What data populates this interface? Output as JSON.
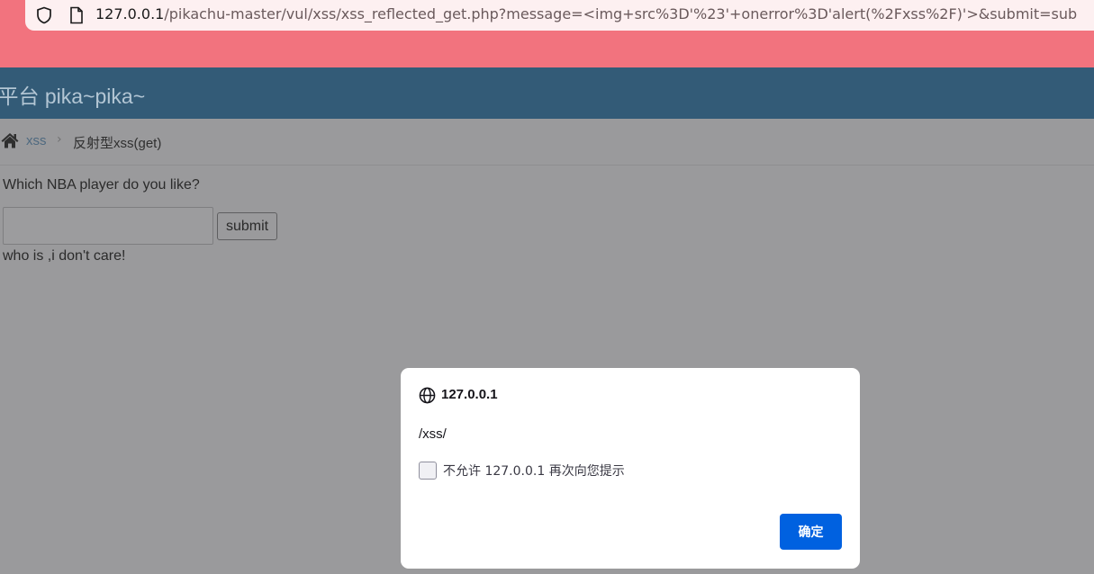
{
  "browser": {
    "url_host": "127.0.0.1",
    "url_rest": "/pikachu-master/vul/xss/xss_reflected_get.php?message=<img+src%3D'%23'+onerror%3D'alert(%2Fxss%2F)'>&submit=sub",
    "icons": [
      "shield-icon",
      "page-icon"
    ]
  },
  "header": {
    "title": "J平台 pika~pika~"
  },
  "breadcrumb": {
    "home_icon": "home-icon",
    "link": "xss",
    "separator": "›",
    "current": "反射型xss(get)"
  },
  "form": {
    "question": "Which NBA player do you like?",
    "input_value": "",
    "submit_label": "submit",
    "result_text": "who is ,i don't care!"
  },
  "dialog": {
    "origin": "127.0.0.1",
    "message": "/xss/",
    "checkbox_label": "不允许 127.0.0.1 再次向您提示",
    "checkbox_checked": false,
    "ok_label": "确定",
    "colors": {
      "ok_button": "#0061e0"
    }
  },
  "colors": {
    "chrome_tint": "#f2737e",
    "header_bg": "#335b77",
    "overlay_bg": "#9a9a9c"
  }
}
